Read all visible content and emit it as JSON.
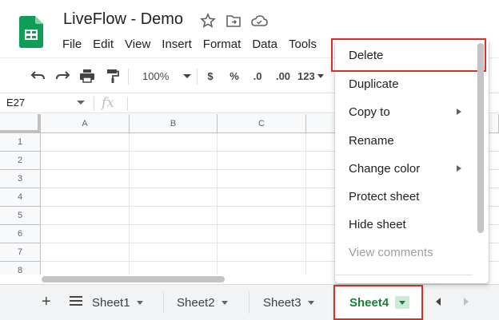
{
  "app": {
    "title": "LiveFlow - Demo",
    "title_icons": [
      "star-icon",
      "move-folder-icon",
      "cloud-status-icon"
    ]
  },
  "menubar": [
    "File",
    "Edit",
    "View",
    "Insert",
    "Format",
    "Data",
    "Tools"
  ],
  "toolbar": {
    "zoom": "100%",
    "currency": "$",
    "percent": "%",
    "decrease_decimals": ".0",
    "increase_decimals": ".00",
    "more_formats": "123"
  },
  "formula_bar": {
    "name_box": "E27",
    "fx": "fx",
    "value": ""
  },
  "grid": {
    "columns": [
      "A",
      "B",
      "C"
    ],
    "rows": [
      "1",
      "2",
      "3",
      "4",
      "5",
      "6",
      "7",
      "8"
    ]
  },
  "sheet_tabs": {
    "tabs": [
      {
        "label": "Sheet1",
        "active": false
      },
      {
        "label": "Sheet2",
        "active": false
      },
      {
        "label": "Sheet3",
        "active": false
      },
      {
        "label": "Sheet4",
        "active": true
      }
    ]
  },
  "context_menu": {
    "items": [
      {
        "label": "Delete",
        "highlighted": true,
        "submenu": false,
        "disabled": false
      },
      {
        "label": "Duplicate",
        "submenu": false,
        "disabled": false
      },
      {
        "label": "Copy to",
        "submenu": true,
        "disabled": false
      },
      {
        "label": "Rename",
        "submenu": false,
        "disabled": false
      },
      {
        "label": "Change color",
        "submenu": true,
        "disabled": false
      },
      {
        "label": "Protect sheet",
        "submenu": false,
        "disabled": false
      },
      {
        "label": "Hide sheet",
        "submenu": false,
        "disabled": false
      },
      {
        "label": "View comments",
        "submenu": false,
        "disabled": true
      }
    ]
  },
  "colors": {
    "brand_green": "#0f9d58",
    "active_tab_text": "#188038",
    "highlight_outline": "#d93025"
  }
}
